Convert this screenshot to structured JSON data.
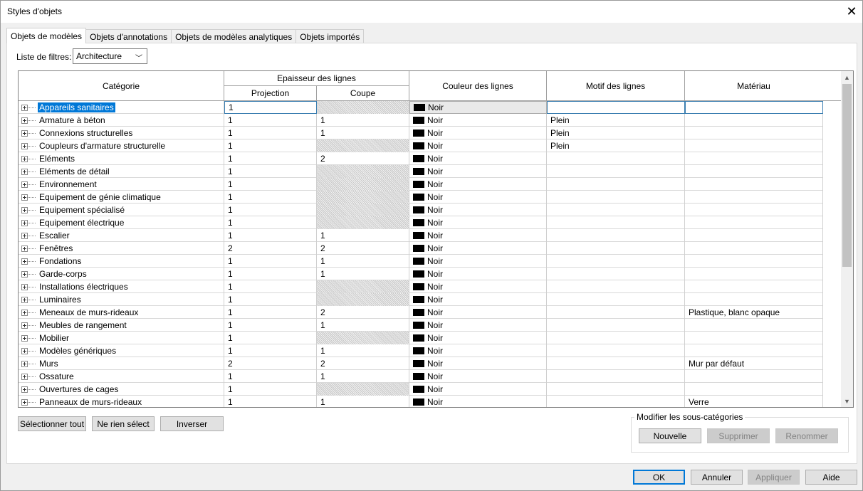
{
  "window": {
    "title": "Styles d'objets"
  },
  "tabs": [
    {
      "label": "Objets de modèles",
      "active": true
    },
    {
      "label": "Objets d'annotations",
      "active": false
    },
    {
      "label": "Objets de modèles analytiques",
      "active": false
    },
    {
      "label": "Objets importés",
      "active": false
    }
  ],
  "filter": {
    "label": "Liste de filtres:",
    "value": "Architecture"
  },
  "table": {
    "headers": {
      "category": "Catégorie",
      "thickness": "Epaisseur des lignes",
      "projection": "Projection",
      "cut": "Coupe",
      "color": "Couleur des lignes",
      "pattern": "Motif des lignes",
      "material": "Matériau"
    },
    "rows": [
      {
        "category": "Appareils sanitaires",
        "projection": "1",
        "cut": "",
        "cut_hatched": true,
        "color": "Noir",
        "pattern": "",
        "material": "",
        "selected": true
      },
      {
        "category": "Armature à béton",
        "projection": "1",
        "cut": "1",
        "cut_hatched": false,
        "color": "Noir",
        "pattern": "Plein",
        "material": ""
      },
      {
        "category": "Connexions structurelles",
        "projection": "1",
        "cut": "1",
        "cut_hatched": false,
        "color": "Noir",
        "pattern": "Plein",
        "material": ""
      },
      {
        "category": "Coupleurs d'armature structurelle",
        "projection": "1",
        "cut": "",
        "cut_hatched": true,
        "color": "Noir",
        "pattern": "Plein",
        "material": ""
      },
      {
        "category": "Eléments",
        "projection": "1",
        "cut": "2",
        "cut_hatched": false,
        "color": "Noir",
        "pattern": "",
        "material": ""
      },
      {
        "category": "Eléments de détail",
        "projection": "1",
        "cut": "",
        "cut_hatched": true,
        "color": "Noir",
        "pattern": "",
        "material": ""
      },
      {
        "category": "Environnement",
        "projection": "1",
        "cut": "",
        "cut_hatched": true,
        "color": "Noir",
        "pattern": "",
        "material": ""
      },
      {
        "category": "Equipement de génie climatique",
        "projection": "1",
        "cut": "",
        "cut_hatched": true,
        "color": "Noir",
        "pattern": "",
        "material": ""
      },
      {
        "category": "Equipement spécialisé",
        "projection": "1",
        "cut": "",
        "cut_hatched": true,
        "color": "Noir",
        "pattern": "",
        "material": ""
      },
      {
        "category": "Equipement électrique",
        "projection": "1",
        "cut": "",
        "cut_hatched": true,
        "color": "Noir",
        "pattern": "",
        "material": ""
      },
      {
        "category": "Escalier",
        "projection": "1",
        "cut": "1",
        "cut_hatched": false,
        "color": "Noir",
        "pattern": "",
        "material": ""
      },
      {
        "category": "Fenêtres",
        "projection": "2",
        "cut": "2",
        "cut_hatched": false,
        "color": "Noir",
        "pattern": "",
        "material": ""
      },
      {
        "category": "Fondations",
        "projection": "1",
        "cut": "1",
        "cut_hatched": false,
        "color": "Noir",
        "pattern": "",
        "material": ""
      },
      {
        "category": "Garde-corps",
        "projection": "1",
        "cut": "1",
        "cut_hatched": false,
        "color": "Noir",
        "pattern": "",
        "material": ""
      },
      {
        "category": "Installations électriques",
        "projection": "1",
        "cut": "",
        "cut_hatched": true,
        "color": "Noir",
        "pattern": "",
        "material": ""
      },
      {
        "category": "Luminaires",
        "projection": "1",
        "cut": "",
        "cut_hatched": true,
        "color": "Noir",
        "pattern": "",
        "material": ""
      },
      {
        "category": "Meneaux de murs-rideaux",
        "projection": "1",
        "cut": "2",
        "cut_hatched": false,
        "color": "Noir",
        "pattern": "",
        "material": "Plastique, blanc opaque"
      },
      {
        "category": "Meubles de rangement",
        "projection": "1",
        "cut": "1",
        "cut_hatched": false,
        "color": "Noir",
        "pattern": "",
        "material": ""
      },
      {
        "category": "Mobilier",
        "projection": "1",
        "cut": "",
        "cut_hatched": true,
        "color": "Noir",
        "pattern": "",
        "material": ""
      },
      {
        "category": "Modèles génériques",
        "projection": "1",
        "cut": "1",
        "cut_hatched": false,
        "color": "Noir",
        "pattern": "",
        "material": ""
      },
      {
        "category": "Murs",
        "projection": "2",
        "cut": "2",
        "cut_hatched": false,
        "color": "Noir",
        "pattern": "",
        "material": "Mur par défaut"
      },
      {
        "category": "Ossature",
        "projection": "1",
        "cut": "1",
        "cut_hatched": false,
        "color": "Noir",
        "pattern": "",
        "material": ""
      },
      {
        "category": "Ouvertures de cages",
        "projection": "1",
        "cut": "",
        "cut_hatched": true,
        "color": "Noir",
        "pattern": "",
        "material": ""
      },
      {
        "category": "Panneaux de murs-rideaux",
        "projection": "1",
        "cut": "1",
        "cut_hatched": false,
        "color": "Noir",
        "pattern": "",
        "material": "Verre"
      }
    ]
  },
  "selection_buttons": {
    "select_all": "Sélectionner tout",
    "select_none": "Ne rien sélect",
    "invert": "Inverser"
  },
  "subcategories": {
    "title": "Modifier les sous-catégories",
    "new": "Nouvelle",
    "delete": "Supprimer",
    "rename": "Renommer"
  },
  "footer": {
    "ok": "OK",
    "cancel": "Annuler",
    "apply": "Appliquer",
    "help": "Aide"
  },
  "colors": {
    "selection": "#0078d7",
    "swatch_noir": "#000000"
  }
}
